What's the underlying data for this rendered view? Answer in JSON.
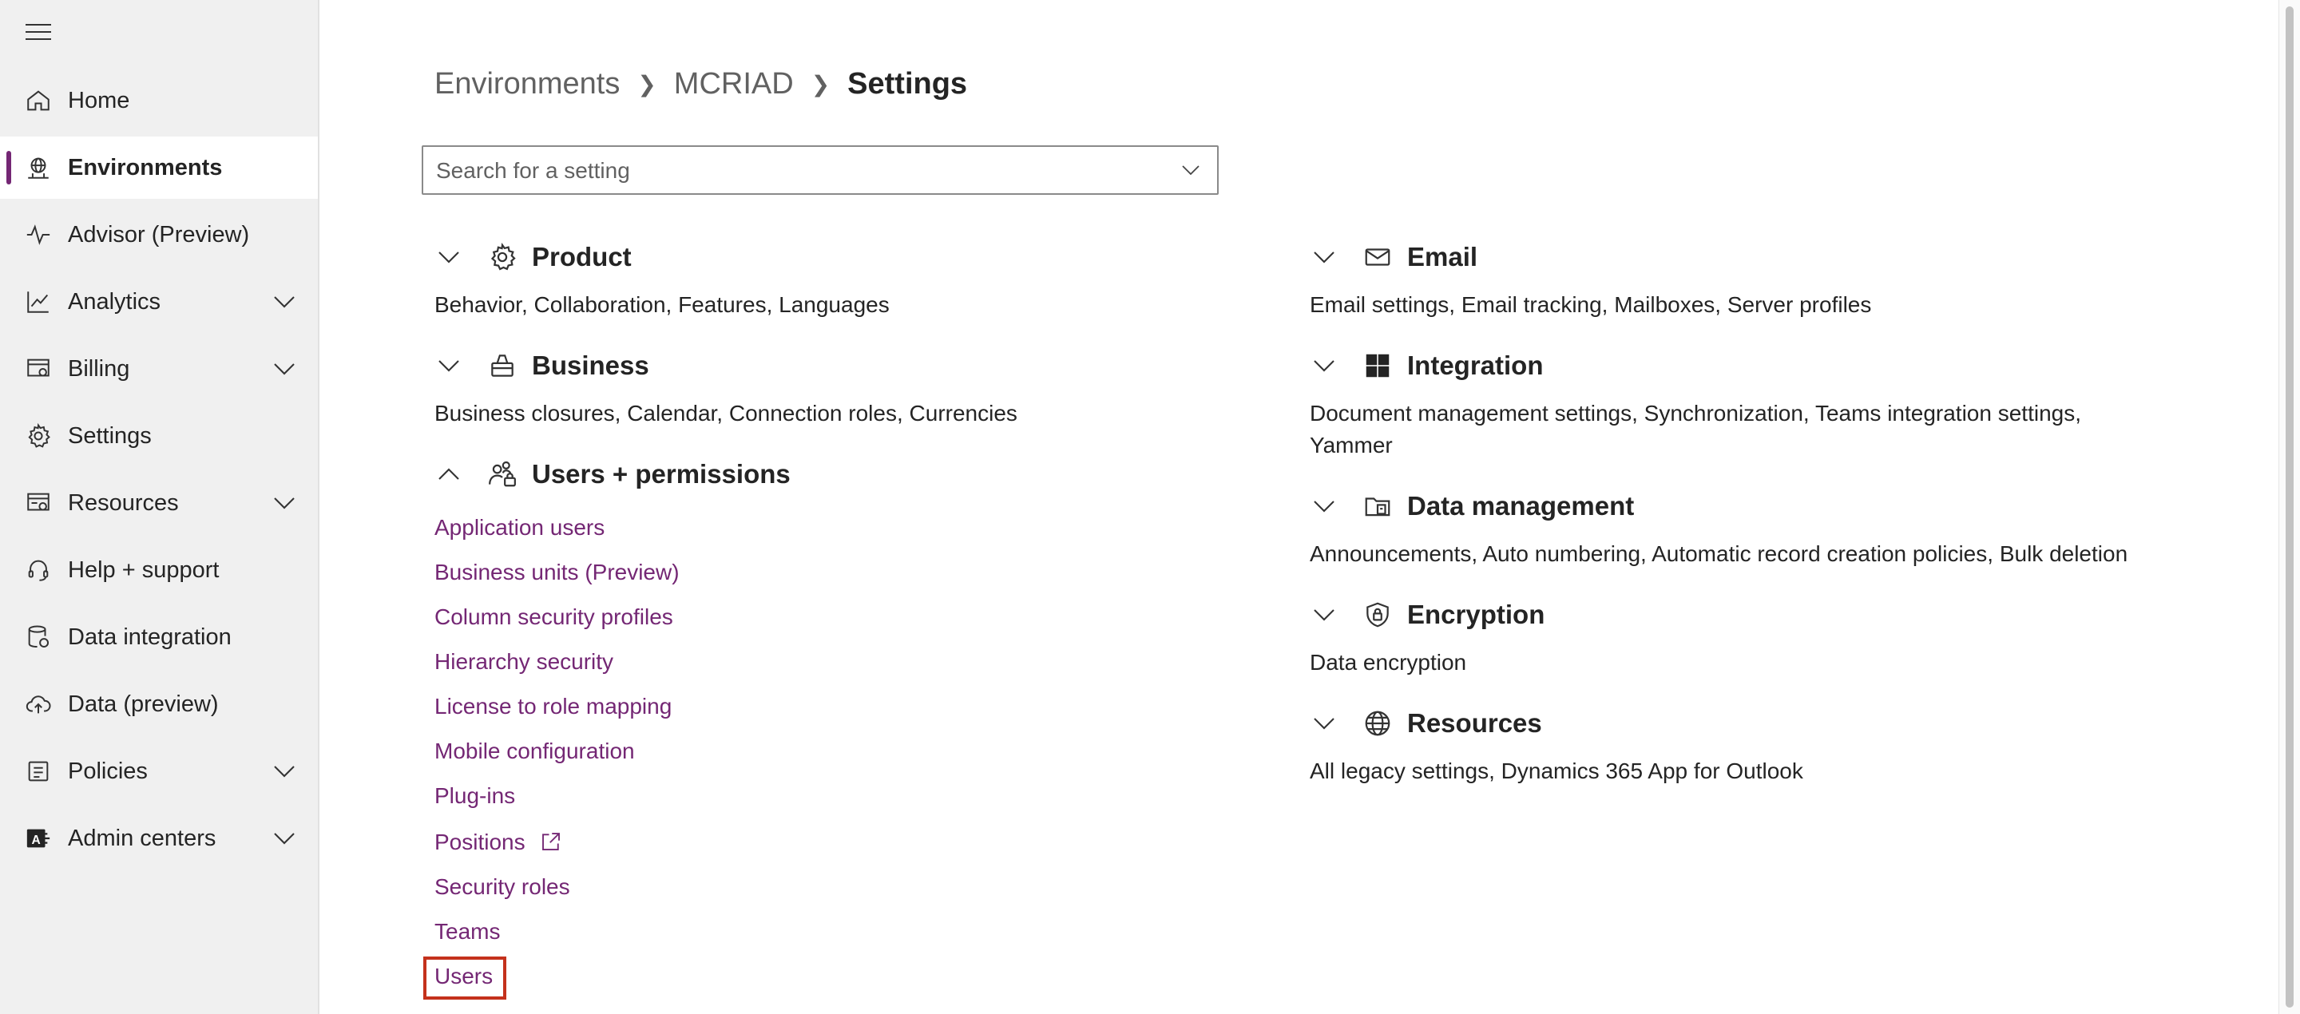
{
  "sidebar": {
    "items": [
      {
        "label": "Home",
        "icon": "home-icon",
        "expandable": false,
        "active": false
      },
      {
        "label": "Environments",
        "icon": "environments-icon",
        "expandable": false,
        "active": true
      },
      {
        "label": "Advisor (Preview)",
        "icon": "pulse-icon",
        "expandable": false,
        "active": false
      },
      {
        "label": "Analytics",
        "icon": "chart-line-icon",
        "expandable": true,
        "active": false
      },
      {
        "label": "Billing",
        "icon": "billing-icon",
        "expandable": true,
        "active": false
      },
      {
        "label": "Settings",
        "icon": "gear-icon",
        "expandable": false,
        "active": false
      },
      {
        "label": "Resources",
        "icon": "resources-icon",
        "expandable": true,
        "active": false
      },
      {
        "label": "Help + support",
        "icon": "headset-icon",
        "expandable": false,
        "active": false
      },
      {
        "label": "Data integration",
        "icon": "database-icon",
        "expandable": false,
        "active": false
      },
      {
        "label": "Data (preview)",
        "icon": "cloud-upload-icon",
        "expandable": false,
        "active": false
      },
      {
        "label": "Policies",
        "icon": "shield-icon",
        "expandable": true,
        "active": false
      },
      {
        "label": "Admin centers",
        "icon": "admin-centers-icon",
        "expandable": true,
        "active": false
      }
    ]
  },
  "breadcrumb": [
    "Environments",
    "MCRIAD",
    "Settings"
  ],
  "search": {
    "placeholder": "Search for a setting"
  },
  "sections_left": [
    {
      "title": "Product",
      "icon": "gear-icon",
      "expanded": false,
      "desc": "Behavior, Collaboration, Features, Languages"
    },
    {
      "title": "Business",
      "icon": "briefcase-icon",
      "expanded": false,
      "desc": "Business closures, Calendar, Connection roles, Currencies"
    },
    {
      "title": "Users + permissions",
      "icon": "people-lock-icon",
      "expanded": true,
      "links": [
        "Application users",
        "Business units (Preview)",
        "Column security profiles",
        "Hierarchy security",
        "License to role mapping",
        "Mobile configuration",
        "Plug-ins",
        "Positions",
        "Security roles",
        "Teams",
        "Users"
      ]
    }
  ],
  "sections_right": [
    {
      "title": "Email",
      "icon": "mail-icon",
      "expanded": false,
      "desc": "Email settings, Email tracking, Mailboxes, Server profiles"
    },
    {
      "title": "Integration",
      "icon": "windows-icon",
      "expanded": false,
      "desc": "Document management settings, Synchronization, Teams integration settings, Yammer"
    },
    {
      "title": "Data management",
      "icon": "data-management-icon",
      "expanded": false,
      "desc": "Announcements, Auto numbering, Automatic record creation policies, Bulk deletion"
    },
    {
      "title": "Encryption",
      "icon": "shield-lock-icon",
      "expanded": false,
      "desc": "Data encryption"
    },
    {
      "title": "Resources",
      "icon": "globe-icon",
      "expanded": false,
      "desc": "All legacy settings, Dynamics 365 App for Outlook"
    }
  ],
  "colors": {
    "accent": "#742774",
    "highlight": "#c4311c"
  }
}
